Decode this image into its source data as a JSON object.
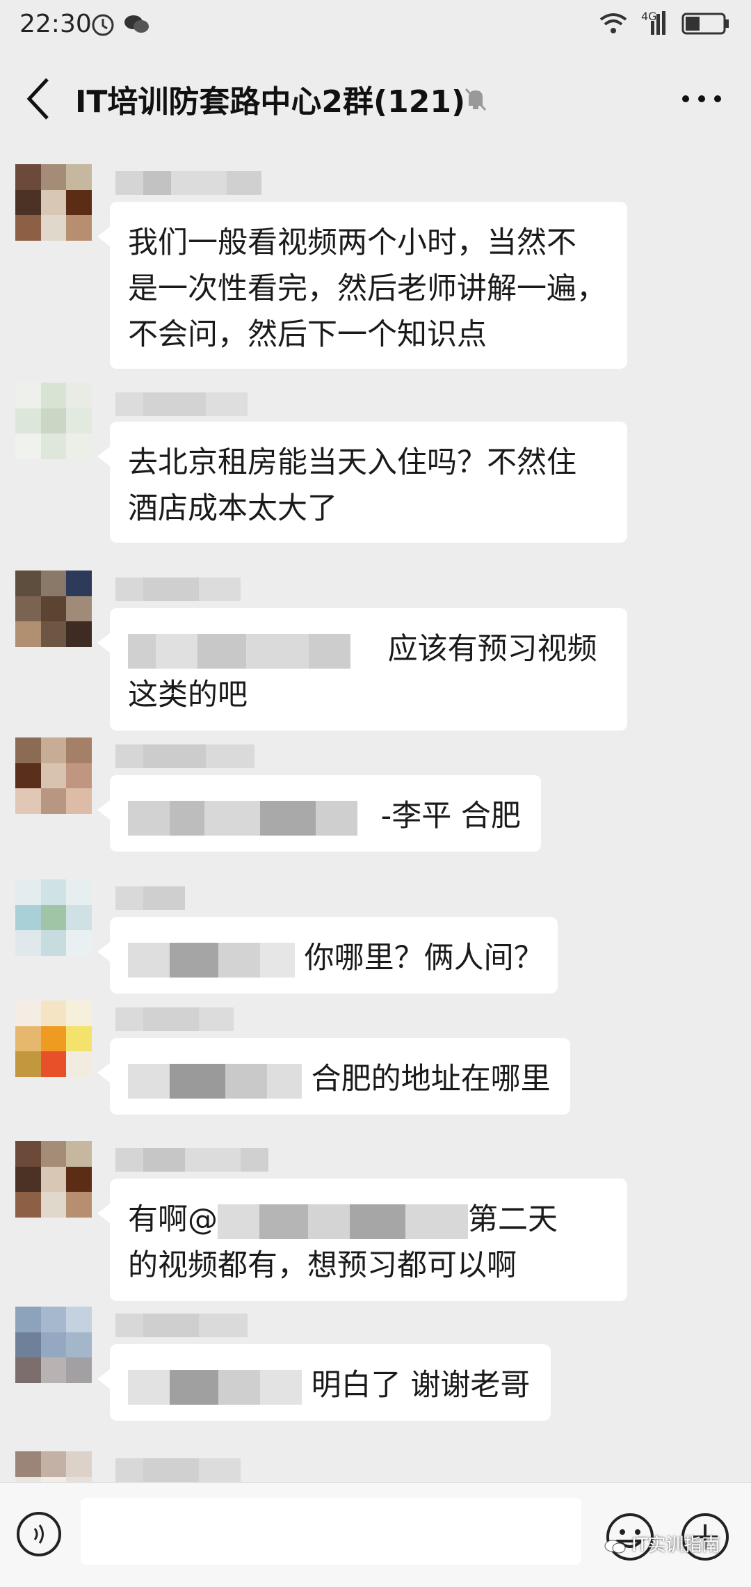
{
  "status_bar": {
    "time": "22:30",
    "network_label": "4G"
  },
  "header": {
    "title": "IT培训防套路中心2群(121)",
    "back_icon": "chevron-left-icon",
    "mute_icon": "bell-off-icon",
    "more_icon": "more-dots-icon"
  },
  "messages": [
    {
      "text_lines": [
        "我们一般看视频两个小时，当然不",
        "是一次性看完，然后老师讲解一遍，",
        "不会问，然后下一个知识点"
      ]
    },
    {
      "text_lines": [
        "去北京租房能当天入住吗？不然住",
        "酒店成本太大了"
      ]
    },
    {
      "text_lines": [
        "应该有预习视频",
        "这类的吧"
      ]
    },
    {
      "text_lines": [
        "-李平  合肥"
      ]
    },
    {
      "text_lines": [
        "你哪里？俩人间？"
      ]
    },
    {
      "text_lines": [
        "合肥的地址在哪里"
      ]
    },
    {
      "text_lines": [
        "有啊@",
        "第二天",
        "的视频都有，想预习都可以啊"
      ]
    },
    {
      "text_lines": [
        "明白了 谢谢老哥"
      ]
    }
  ],
  "input_bar": {
    "voice_icon": "voice-icon",
    "emoji_icon": "emoji-icon",
    "plus_icon": "plus-icon"
  },
  "watermark": {
    "text": "IT实训指南"
  }
}
